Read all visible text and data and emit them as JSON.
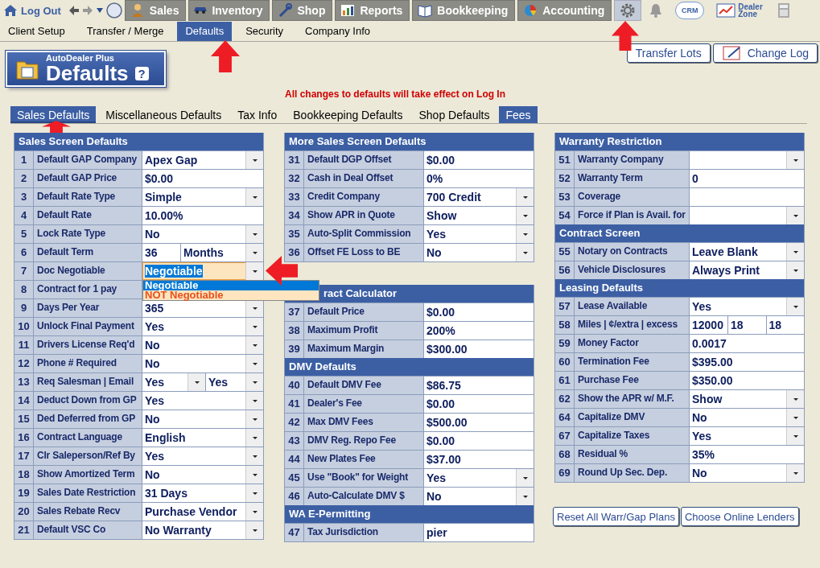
{
  "top_bar": {
    "logout": "Log Out",
    "modules": [
      {
        "label": "Sales"
      },
      {
        "label": "Inventory"
      },
      {
        "label": "Shop"
      },
      {
        "label": "Reports"
      },
      {
        "label": "Bookkeeping"
      },
      {
        "label": "Accounting"
      }
    ],
    "tools": [
      {
        "kind": "settings",
        "selected": true
      },
      {
        "kind": "bell",
        "selected": false
      },
      {
        "kind": "crm",
        "label": "CRM",
        "selected": false
      },
      {
        "kind": "dealer_zone",
        "label": "Dealer Zone",
        "selected": false
      },
      {
        "kind": "calculator",
        "selected": false
      }
    ]
  },
  "menu": [
    {
      "label": "Client Setup",
      "selected": false
    },
    {
      "label": "Transfer / Merge",
      "selected": false
    },
    {
      "label": "Defaults",
      "selected": true
    },
    {
      "label": "Security",
      "selected": false
    },
    {
      "label": "Company Info",
      "selected": false
    }
  ],
  "page_badge": {
    "product": "AutoDealer Plus",
    "title": "Defaults",
    "help": "?"
  },
  "header_buttons": [
    "Transfer Lots",
    "Change Log"
  ],
  "notice": "All changes to defaults will take effect on Log In",
  "sub_tabs": [
    {
      "label": "Sales Defaults",
      "selected": true,
      "highlighted": false
    },
    {
      "label": "Miscellaneous Defaults",
      "selected": false,
      "highlighted": false
    },
    {
      "label": "Tax Info",
      "selected": false,
      "highlighted": false
    },
    {
      "label": "Bookkeeping Defaults",
      "selected": false,
      "highlighted": false
    },
    {
      "label": "Shop Defaults",
      "selected": false,
      "highlighted": false
    },
    {
      "label": "Fees",
      "selected": false,
      "highlighted": true
    }
  ],
  "columns": [
    {
      "groups": [
        {
          "sections": [
            {
              "title": "Sales Screen Defaults",
              "rows": [
                {
                  "num": "1",
                  "label": "Default GAP Company",
                  "fields": [
                    {
                      "kind": "select",
                      "value": "Apex Gap",
                      "focused": false
                    }
                  ]
                },
                {
                  "num": "2",
                  "label": "Default GAP Price",
                  "fields": [
                    {
                      "kind": "text",
                      "value": "$0.00",
                      "focused": false
                    }
                  ]
                },
                {
                  "num": "3",
                  "label": "Default Rate Type",
                  "fields": [
                    {
                      "kind": "select",
                      "value": "Simple",
                      "focused": false
                    }
                  ]
                },
                {
                  "num": "4",
                  "label": "Default Rate",
                  "fields": [
                    {
                      "kind": "text",
                      "value": "10.00%",
                      "focused": false
                    }
                  ]
                },
                {
                  "num": "5",
                  "label": "Lock Rate Type",
                  "fields": [
                    {
                      "kind": "select",
                      "value": "No",
                      "focused": false
                    }
                  ]
                },
                {
                  "num": "6",
                  "label": "Default Term",
                  "fields": [
                    {
                      "kind": "text",
                      "value": "36",
                      "focused": false
                    },
                    {
                      "kind": "select",
                      "value": "Months",
                      "focused": false
                    }
                  ]
                },
                {
                  "num": "7",
                  "label": "Doc Negotiable",
                  "fields": [
                    {
                      "kind": "select",
                      "value": "Negotiable",
                      "focused": true,
                      "options": [
                        {
                          "label": "Negotiable",
                          "selected": true
                        },
                        {
                          "label": "NOT Negotiable",
                          "selected": false
                        }
                      ]
                    }
                  ]
                },
                {
                  "num": "8",
                  "label": "Contract for 1 pay"
                },
                {
                  "num": "9",
                  "label": "Days Per Year",
                  "fields": [
                    {
                      "kind": "select",
                      "value": "365",
                      "focused": false
                    }
                  ]
                },
                {
                  "num": "10",
                  "label": "Unlock Final Payment",
                  "fields": [
                    {
                      "kind": "select",
                      "value": "Yes",
                      "focused": false
                    }
                  ]
                },
                {
                  "num": "11",
                  "label": "Drivers License Req'd",
                  "fields": [
                    {
                      "kind": "select",
                      "value": "No",
                      "focused": false
                    }
                  ]
                },
                {
                  "num": "12",
                  "label": "Phone # Required",
                  "fields": [
                    {
                      "kind": "select",
                      "value": "No",
                      "focused": false
                    }
                  ]
                },
                {
                  "num": "13",
                  "label": "Req Salesman | Email",
                  "fields": [
                    {
                      "kind": "select",
                      "value": "Yes",
                      "focused": false
                    },
                    {
                      "kind": "select",
                      "value": "Yes",
                      "focused": false
                    }
                  ]
                },
                {
                  "num": "14",
                  "label": "Deduct Down from GP",
                  "fields": [
                    {
                      "kind": "select",
                      "value": "Yes",
                      "focused": false
                    }
                  ]
                },
                {
                  "num": "15",
                  "label": "Ded Deferred from GP",
                  "fields": [
                    {
                      "kind": "select",
                      "value": "No",
                      "focused": false
                    }
                  ]
                },
                {
                  "num": "16",
                  "label": "Contract Language",
                  "fields": [
                    {
                      "kind": "select",
                      "value": "English",
                      "focused": false
                    }
                  ]
                },
                {
                  "num": "17",
                  "label": "Clr Saleperson/Ref By",
                  "fields": [
                    {
                      "kind": "select",
                      "value": "Yes",
                      "focused": false
                    }
                  ]
                },
                {
                  "num": "18",
                  "label": "Show Amortized Term",
                  "fields": [
                    {
                      "kind": "select",
                      "value": "No",
                      "focused": false
                    }
                  ]
                },
                {
                  "num": "19",
                  "label": "Sales Date Restriction",
                  "fields": [
                    {
                      "kind": "select",
                      "value": "31 Days",
                      "focused": false
                    }
                  ]
                },
                {
                  "num": "20",
                  "label": "Sales Rebate Recv",
                  "fields": [
                    {
                      "kind": "select",
                      "value": "Purchase Vendor",
                      "focused": false
                    }
                  ]
                },
                {
                  "num": "21",
                  "label": "Default VSC Co",
                  "fields": [
                    {
                      "kind": "select",
                      "value": "No Warranty",
                      "focused": false
                    }
                  ]
                }
              ]
            }
          ]
        }
      ]
    },
    {
      "groups": [
        {
          "sections": [
            {
              "title": "More Sales Screen Defaults",
              "rows": [
                {
                  "num": "31",
                  "label": "Default DGP Offset",
                  "fields": [
                    {
                      "kind": "text",
                      "value": "$0.00",
                      "focused": false
                    }
                  ]
                },
                {
                  "num": "32",
                  "label": "Cash in Deal Offset",
                  "fields": [
                    {
                      "kind": "text",
                      "value": "0%",
                      "focused": false
                    }
                  ]
                },
                {
                  "num": "33",
                  "label": "Credit Company",
                  "fields": [
                    {
                      "kind": "select",
                      "value": "700 Credit",
                      "focused": false
                    }
                  ]
                },
                {
                  "num": "34",
                  "label": "Show APR in Quote",
                  "fields": [
                    {
                      "kind": "select",
                      "value": "Show",
                      "focused": false
                    }
                  ]
                },
                {
                  "num": "35",
                  "label": "Auto-Split Commission",
                  "fields": [
                    {
                      "kind": "select",
                      "value": "Yes",
                      "focused": false
                    }
                  ]
                },
                {
                  "num": "36",
                  "label": "Offset FE Loss to BE",
                  "fields": [
                    {
                      "kind": "select",
                      "value": "No",
                      "focused": false
                    }
                  ]
                }
              ]
            }
          ]
        },
        {
          "sections": [
            {
              "title": "ract Calculator",
              "rows": [
                {
                  "num": "37",
                  "label": "Default Price",
                  "fields": [
                    {
                      "kind": "text",
                      "value": "$0.00",
                      "focused": false
                    }
                  ]
                },
                {
                  "num": "38",
                  "label": "Maximum Profit",
                  "fields": [
                    {
                      "kind": "text",
                      "value": "200%",
                      "focused": false
                    }
                  ]
                },
                {
                  "num": "39",
                  "label": "Maximum Margin",
                  "fields": [
                    {
                      "kind": "text",
                      "value": "$300.00",
                      "focused": false
                    }
                  ]
                }
              ]
            },
            {
              "title": "DMV Defaults",
              "rows": [
                {
                  "num": "40",
                  "label": "Default DMV Fee",
                  "fields": [
                    {
                      "kind": "text",
                      "value": "$86.75",
                      "focused": false
                    }
                  ]
                },
                {
                  "num": "41",
                  "label": "Dealer's Fee",
                  "fields": [
                    {
                      "kind": "text",
                      "value": "$0.00",
                      "focused": false
                    }
                  ]
                },
                {
                  "num": "42",
                  "label": "Max DMV Fees",
                  "fields": [
                    {
                      "kind": "text",
                      "value": "$500.00",
                      "focused": false
                    }
                  ]
                },
                {
                  "num": "43",
                  "label": "DMV Reg. Repo Fee",
                  "fields": [
                    {
                      "kind": "text",
                      "value": "$0.00",
                      "focused": false
                    }
                  ]
                },
                {
                  "num": "44",
                  "label": "New Plates Fee",
                  "fields": [
                    {
                      "kind": "text",
                      "value": "$37.00",
                      "focused": false
                    }
                  ]
                },
                {
                  "num": "45",
                  "label": "Use \"Book\" for Weight",
                  "fields": [
                    {
                      "kind": "select",
                      "value": "Yes",
                      "focused": false
                    }
                  ]
                },
                {
                  "num": "46",
                  "label": "Auto-Calculate DMV $",
                  "fields": [
                    {
                      "kind": "select",
                      "value": "No",
                      "focused": false
                    }
                  ]
                }
              ]
            },
            {
              "title": "WA E-Permitting",
              "rows": [
                {
                  "num": "47",
                  "label": "Tax Jurisdiction",
                  "fields": [
                    {
                      "kind": "text",
                      "value": "pier",
                      "focused": false
                    }
                  ]
                }
              ]
            }
          ]
        }
      ]
    },
    {
      "groups": [
        {
          "sections": [
            {
              "title": "Warranty Restriction",
              "rows": [
                {
                  "num": "51",
                  "label": "Warranty Company",
                  "fields": [
                    {
                      "kind": "select",
                      "focused": false
                    }
                  ]
                },
                {
                  "num": "52",
                  "label": "Warranty Term",
                  "fields": [
                    {
                      "kind": "text",
                      "value": "0",
                      "focused": false
                    }
                  ]
                },
                {
                  "num": "53",
                  "label": "Coverage",
                  "fields": [
                    {
                      "kind": "text",
                      "focused": false
                    }
                  ]
                },
                {
                  "num": "54",
                  "label": "Force if Plan is Avail. for",
                  "fields": [
                    {
                      "kind": "select",
                      "focused": false
                    }
                  ]
                }
              ]
            },
            {
              "title": "Contract Screen",
              "rows": [
                {
                  "num": "55",
                  "label": "Notary on Contracts",
                  "fields": [
                    {
                      "kind": "select",
                      "value": "Leave Blank",
                      "focused": false
                    }
                  ]
                },
                {
                  "num": "56",
                  "label": "Vehicle Disclosures",
                  "fields": [
                    {
                      "kind": "select",
                      "value": "Always Print",
                      "focused": false
                    }
                  ]
                }
              ]
            },
            {
              "title": "Leasing Defaults",
              "rows": [
                {
                  "num": "57",
                  "label": "Lease Available",
                  "fields": [
                    {
                      "kind": "select",
                      "value": "Yes",
                      "focused": false
                    }
                  ]
                },
                {
                  "num": "58",
                  "label": "Miles | ¢/extra | excess",
                  "fields": [
                    {
                      "kind": "text",
                      "value": "12000",
                      "focused": false
                    },
                    {
                      "kind": "text",
                      "value": "18",
                      "focused": false
                    },
                    {
                      "kind": "text",
                      "value": "18",
                      "focused": false
                    }
                  ]
                },
                {
                  "num": "59",
                  "label": "Money Factor",
                  "fields": [
                    {
                      "kind": "text",
                      "value": "0.0017",
                      "focused": false
                    }
                  ]
                },
                {
                  "num": "60",
                  "label": "Termination Fee",
                  "fields": [
                    {
                      "kind": "text",
                      "value": "$395.00",
                      "focused": false
                    }
                  ]
                },
                {
                  "num": "61",
                  "label": "Purchase Fee",
                  "fields": [
                    {
                      "kind": "text",
                      "value": "$350.00",
                      "focused": false
                    }
                  ]
                },
                {
                  "num": "62",
                  "label": "Show the APR w/ M.F.",
                  "fields": [
                    {
                      "kind": "select",
                      "value": "Show",
                      "focused": false
                    }
                  ]
                },
                {
                  "num": "64",
                  "label": "Capitalize DMV",
                  "fields": [
                    {
                      "kind": "select",
                      "value": "No",
                      "focused": false
                    }
                  ]
                },
                {
                  "num": "67",
                  "label": "Capitalize Taxes",
                  "fields": [
                    {
                      "kind": "select",
                      "value": "Yes",
                      "focused": false
                    }
                  ]
                },
                {
                  "num": "68",
                  "label": "Residual %",
                  "fields": [
                    {
                      "kind": "text",
                      "value": "35%",
                      "focused": false
                    }
                  ]
                },
                {
                  "num": "69",
                  "label": "Round Up Sec. Dep.",
                  "fields": [
                    {
                      "kind": "select",
                      "value": "No",
                      "focused": false
                    }
                  ]
                }
              ]
            }
          ]
        }
      ],
      "buttons": [
        "Reset All Warr/Gap Plans",
        "Choose Online Lenders"
      ]
    }
  ]
}
